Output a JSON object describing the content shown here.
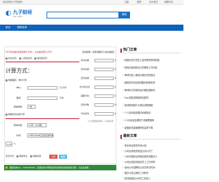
{
  "topbar": {
    "left_text": "欢迎来到九子财经网",
    "links": [
      "注册",
      "登录",
      "设为首页",
      "收藏本站"
    ]
  },
  "header": {
    "logo_text": "九子财经",
    "logo_sub": "JIUZI CAIJING",
    "search_placeholder": "",
    "search_button": "搜索"
  },
  "nav": {
    "items": [
      "首页",
      "理财咨询"
    ]
  },
  "calculator": {
    "info_line": "2019年最新贷款利率4.90%，公积金利率3.25%",
    "radio_labels": [
      "商业贷款",
      "公积金贷款",
      "组合型贷款"
    ],
    "title": "计算方式：",
    "method_option": "根据面积、单价计算",
    "unit_price_label": "单价：",
    "unit_price_unit": "元/平米",
    "area_label": "面积：",
    "area_unit": "平米",
    "ratio_label": "按揭成数：",
    "ratio_value": "7成",
    "loan_total_option": "根据贷款总额计算",
    "years_label": "按揭年数：",
    "years_value": "20年（240期）",
    "rate_label": "利率：",
    "rate_value": "19年10月08日最新基准利率",
    "rate_input": "4.90",
    "rate_unit": "%",
    "repay_label": "还款方式：",
    "repay_options": [
      "等额本息",
      "等额本金"
    ],
    "calc_button": "计算",
    "reset_button": "重填"
  },
  "results": {
    "heading": "查询结果（如有需要可以修改数值）",
    "rows": [
      {
        "label": "房款总额：",
        "unit": "元"
      },
      {
        "label": "贷款总额：",
        "unit": "元"
      },
      {
        "label": "还款总额：",
        "unit": "元"
      },
      {
        "label": "支付利息款：",
        "unit": "元"
      },
      {
        "label": "首期付款：",
        "unit": "元"
      },
      {
        "label": "贷款月数：",
        "unit": "月"
      },
      {
        "label": "月均还款：",
        "unit": "元"
      }
    ],
    "note": "*以上结果仅供参考，以实际为准"
  },
  "footer_bar": {
    "text": "理财咨询QQ：2790486461，如果您的计算器出现有误或者问题请联系我们，请多多指教。"
  },
  "sidebar": {
    "hot_title": "热门文章",
    "hot_items": [
      "我国对西方历史上最重视的税收制度",
      "税收征管用的自己的哪些工作内容",
      "律师在投入使用办理业务的做法",
      "国税发布将优惠调整的政策安排",
      "律师执行的原则及问题处理原则",
      "Gap加盟流程值得加盟吗",
      "各地财政部扩大落实减税措施",
      "个人如何选择国债和城投债",
      "1.5月高收益理财产品期限推荐",
      "金融机构金融理财收益率下降"
    ],
    "new_title": "最新文章",
    "new_items": [
      "李永林证券的市场价值",
      "公司证券投资收益业绩公开了",
      "人民币国际化进程加快的重要意义",
      "公司应该如何提高员工工作效率",
      "各地公开招聘的公务员考试时间",
      "国企行政主管的工作职责",
      "如何能提高公司员工的收入"
    ]
  },
  "colors": {
    "brand_blue": "#1a6fc4",
    "nav_blue": "#0f62b9",
    "accent_red": "#c8102e",
    "footer_green": "#2f8a3a"
  }
}
